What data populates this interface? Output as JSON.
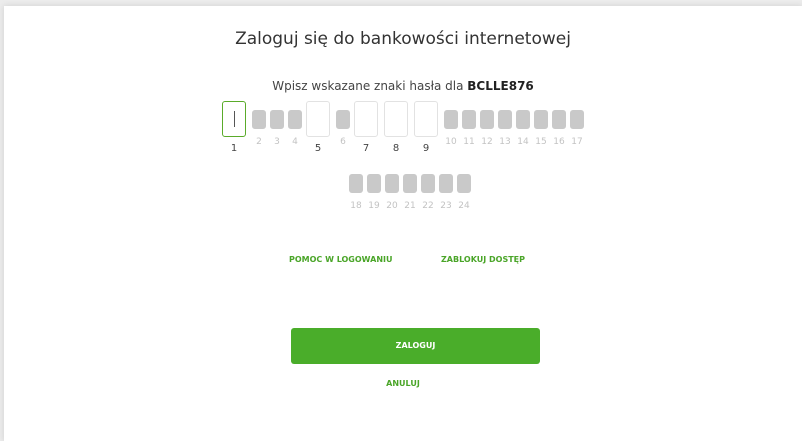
{
  "header": {
    "title": "Zaloguj się do bankowości internetowej"
  },
  "prompt": {
    "text": "Wpisz wskazane znaki hasła dla ",
    "username": "BCLLE876"
  },
  "password_chars": {
    "row1": [
      {
        "n": "1",
        "state": "active"
      },
      {
        "n": "2",
        "state": "masked"
      },
      {
        "n": "3",
        "state": "masked"
      },
      {
        "n": "4",
        "state": "masked"
      },
      {
        "n": "5",
        "state": "open"
      },
      {
        "n": "6",
        "state": "masked"
      },
      {
        "n": "7",
        "state": "open"
      },
      {
        "n": "8",
        "state": "open"
      },
      {
        "n": "9",
        "state": "open"
      },
      {
        "n": "10",
        "state": "masked"
      },
      {
        "n": "11",
        "state": "masked"
      },
      {
        "n": "12",
        "state": "masked"
      },
      {
        "n": "13",
        "state": "masked"
      },
      {
        "n": "14",
        "state": "masked"
      },
      {
        "n": "15",
        "state": "masked"
      },
      {
        "n": "16",
        "state": "masked"
      },
      {
        "n": "17",
        "state": "masked"
      }
    ],
    "row2": [
      {
        "n": "18",
        "state": "masked"
      },
      {
        "n": "19",
        "state": "masked"
      },
      {
        "n": "20",
        "state": "masked"
      },
      {
        "n": "21",
        "state": "masked"
      },
      {
        "n": "22",
        "state": "masked"
      },
      {
        "n": "23",
        "state": "masked"
      },
      {
        "n": "24",
        "state": "masked"
      }
    ]
  },
  "links": {
    "help": "POMOC W LOGOWANIU",
    "block": "ZABLOKUJ DOSTĘP"
  },
  "actions": {
    "login": "ZALOGUJ",
    "cancel": "ANULUJ"
  },
  "colors": {
    "accent": "#4aad2a",
    "masked": "#c9c9c9"
  }
}
